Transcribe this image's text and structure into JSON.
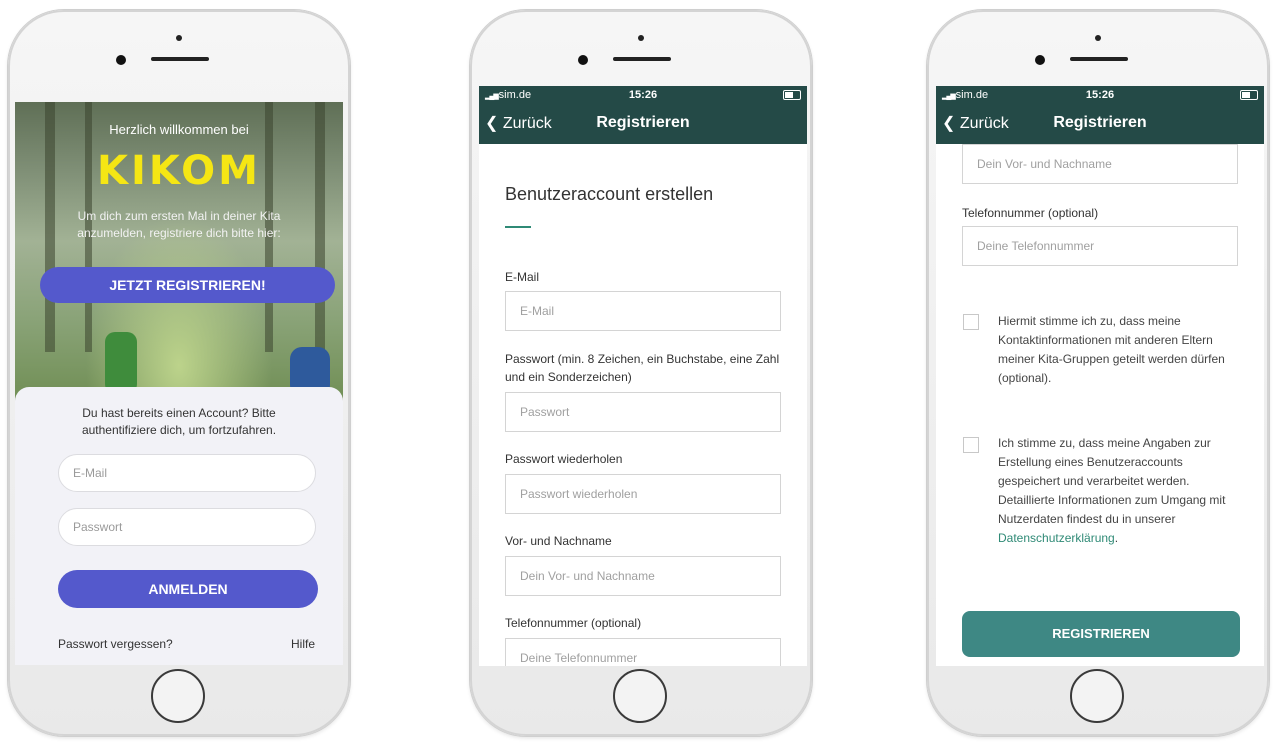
{
  "colors": {
    "nav_bg": "#244a47",
    "brand_purple": "#5459cc",
    "accent_green": "#2f8a76",
    "submit_teal": "#3e8884",
    "logo_yellow": "#f5e614"
  },
  "phone1": {
    "welcome": "Herzlich willkommen bei",
    "logo": "KIKOM",
    "intro": "Um dich zum ersten Mal in deiner Kita anzumelden, registriere dich bitte hier:",
    "register_button": "JETZT REGISTRIEREN!",
    "login_prompt": "Du hast bereits einen Account? Bitte authentifiziere dich, um fortzufahren.",
    "email_placeholder": "E-Mail",
    "password_placeholder": "Passwort",
    "login_button": "ANMELDEN",
    "forgot_password": "Passwort vergessen?",
    "help": "Hilfe"
  },
  "phone2": {
    "status": {
      "carrier": "sim.de",
      "time": "15:26"
    },
    "nav": {
      "back": "Zurück",
      "title": "Registrieren"
    },
    "heading": "Benutzeraccount erstellen",
    "fields": [
      {
        "label": "E-Mail",
        "placeholder": "E-Mail"
      },
      {
        "label": "Passwort (min. 8 Zeichen, ein Buchstabe, eine Zahl und ein Sonderzeichen)",
        "placeholder": "Passwort"
      },
      {
        "label": "Passwort wiederholen",
        "placeholder": "Passwort wiederholen"
      },
      {
        "label": "Vor- und Nachname",
        "placeholder": "Dein Vor- und Nachname"
      },
      {
        "label": "Telefonnummer (optional)",
        "placeholder": "Deine Telefonnummer"
      }
    ]
  },
  "phone3": {
    "status": {
      "carrier": "sim.de",
      "time": "15:26"
    },
    "nav": {
      "back": "Zurück",
      "title": "Registrieren"
    },
    "name_placeholder": "Dein Vor- und Nachname",
    "phone_label": "Telefonnummer (optional)",
    "phone_placeholder": "Deine Telefonnummer",
    "consent_contact": "Hiermit stimme ich zu, dass meine Kontaktinformationen mit anderen Eltern meiner Kita-Gruppen geteilt werden dürfen (optional).",
    "consent_data": "Ich stimme zu, dass meine Angaben zur Erstellung eines Benutzeraccounts gespeichert und verarbeitet werden. Detaillierte Informationen zum Umgang mit Nutzerdaten findest du in unserer",
    "privacy_link": "Datenschutzerklärung",
    "privacy_suffix": ".",
    "submit_button": "REGISTRIEREN"
  }
}
